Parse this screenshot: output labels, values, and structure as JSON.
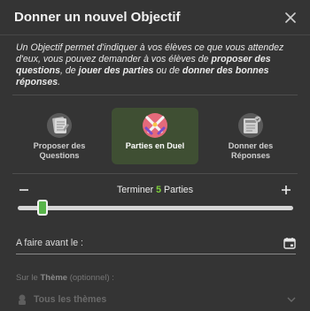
{
  "dialog": {
    "title": "Donner un nouvel Objectif",
    "intro": {
      "p1": "Un Objectif permet d'indiquer à vos élèves ce que vous attendez d'eux, vous pouvez demander à vos élèves de ",
      "b1": "proposer des questions",
      "p2": ", de ",
      "b2": "jouer des parties",
      "p3": " ou de ",
      "b3": "donner des bonnes réponses",
      "p4": "."
    }
  },
  "options": [
    {
      "label_line1": "Proposer des",
      "label_line2": "Questions",
      "icon": "document-stack-icon",
      "selected": false
    },
    {
      "label_line1": "Parties en Duel",
      "label_line2": "",
      "icon": "crossed-swords-icon",
      "selected": true
    },
    {
      "label_line1": "Donner des",
      "label_line2": "Réponses",
      "icon": "quiz-card-icon",
      "selected": false
    }
  ],
  "slider": {
    "prefix": "Terminer",
    "count": "5",
    "suffix": "Parties",
    "level": 0.075
  },
  "date": {
    "label": "A faire avant le :"
  },
  "theme": {
    "label_prefix": "Sur le",
    "label_bold": "Thème",
    "label_suffix": "(optionnel) :",
    "value": "Tous les thèmes"
  },
  "colors": {
    "background": "#343434",
    "accent": "#7ed13b",
    "selected_option": "#3f4f33",
    "thumb": "#58b54a"
  }
}
